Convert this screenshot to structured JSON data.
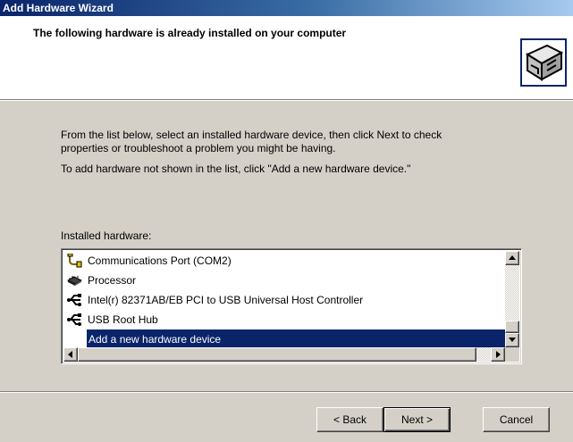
{
  "window": {
    "title": "Add Hardware Wizard"
  },
  "header": {
    "title": "The following hardware is already installed on your computer",
    "icon": "hardware-wizard-icon"
  },
  "instructions": {
    "line1": "From the list below, select an installed hardware device, then click Next to check",
    "line2": "properties or troubleshoot a problem you might be having.",
    "line3": "To add hardware not shown in the list, click \"Add a new hardware device.\""
  },
  "list": {
    "label": "Installed hardware:",
    "items": [
      {
        "label": "Communications Port (COM2)",
        "icon": "port-icon"
      },
      {
        "label": "Processor",
        "icon": "processor-icon"
      },
      {
        "label": "Intel(r) 82371AB/EB PCI to USB Universal Host Controller",
        "icon": "usb-icon"
      },
      {
        "label": "USB Root Hub",
        "icon": "usb-icon"
      },
      {
        "label": "Add a new hardware device",
        "icon": "",
        "selected": true
      }
    ]
  },
  "buttons": {
    "back": "< Back",
    "next": "Next >",
    "cancel": "Cancel"
  },
  "colors": {
    "selection": "#0a246a",
    "dialog": "#d4d0c8",
    "title_start": "#0a246a",
    "title_end": "#a6caf0"
  }
}
